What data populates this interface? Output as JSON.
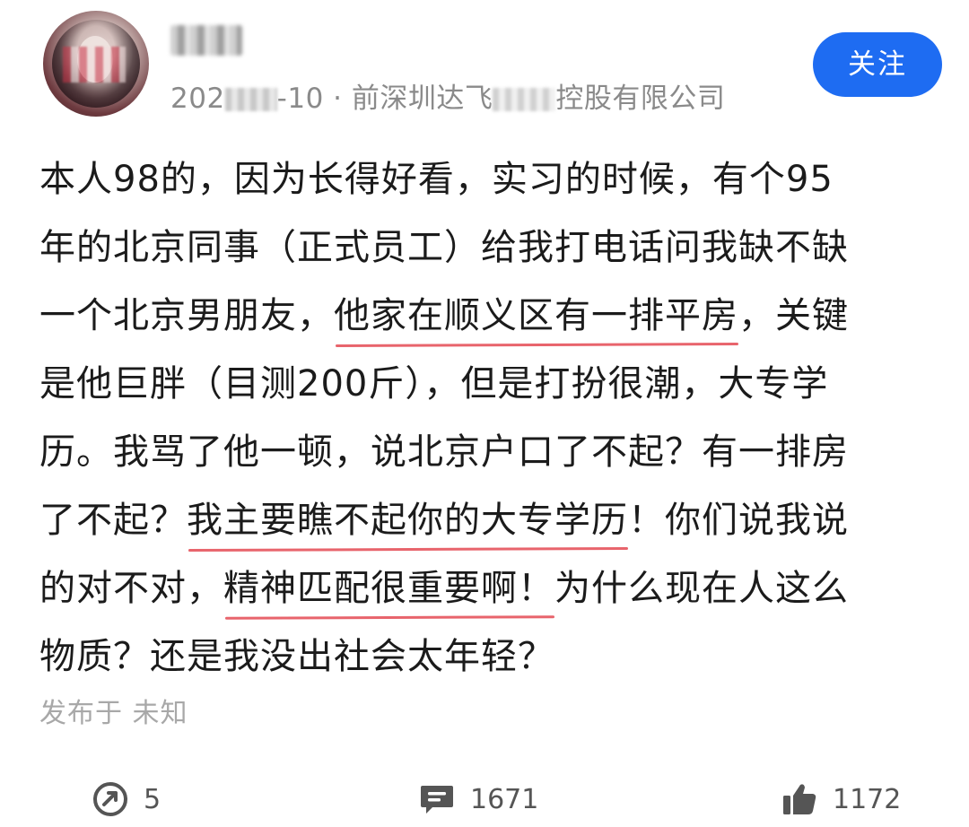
{
  "header": {
    "date_visible_start": "202",
    "date_visible_end": "-10",
    "separator": "·",
    "company_visible_start": "前深圳达飞",
    "company_visible_end": "控股有限公司",
    "follow_label": "关注"
  },
  "post": {
    "lines": [
      {
        "segments": [
          {
            "text": "本人98的，因为长得好看，实习的时候，有个95",
            "hl": false
          }
        ]
      },
      {
        "segments": [
          {
            "text": "年的北京同事（正式员工）给我打电话问我缺不缺",
            "hl": false
          }
        ]
      },
      {
        "segments": [
          {
            "text": "一个北京男朋友，",
            "hl": false
          },
          {
            "text": "他家在顺义区有一排平房",
            "hl": true
          },
          {
            "text": "，关键",
            "hl": false
          }
        ]
      },
      {
        "segments": [
          {
            "text": "是他巨胖（目测200斤），但是打扮很潮，大专学",
            "hl": false
          }
        ]
      },
      {
        "segments": [
          {
            "text": "历。我骂了他一顿，说北京户口了不起？有一排房",
            "hl": false
          }
        ]
      },
      {
        "segments": [
          {
            "text": "了不起？",
            "hl": false
          },
          {
            "text": "我主要瞧不起你的大专学历",
            "hl": true
          },
          {
            "text": "！你们说我说",
            "hl": false
          }
        ]
      },
      {
        "segments": [
          {
            "text": "的对不对，",
            "hl": false
          },
          {
            "text": "精神匹配很重要啊！",
            "hl": true
          },
          {
            "text": "为什么现在人这么",
            "hl": false
          }
        ]
      },
      {
        "segments": [
          {
            "text": "物质？还是我没出社会太年轻？",
            "hl": false
          }
        ]
      }
    ],
    "published_label": "发布于 未知"
  },
  "actions": {
    "share_count": "5",
    "comment_count": "1671",
    "like_count": "1172"
  },
  "colors": {
    "accent": "#1e6cf2",
    "underline": "#e8646c",
    "meta_text": "#8a8a8a"
  },
  "icons": [
    "share-icon",
    "comment-icon",
    "thumbs-up-icon"
  ]
}
